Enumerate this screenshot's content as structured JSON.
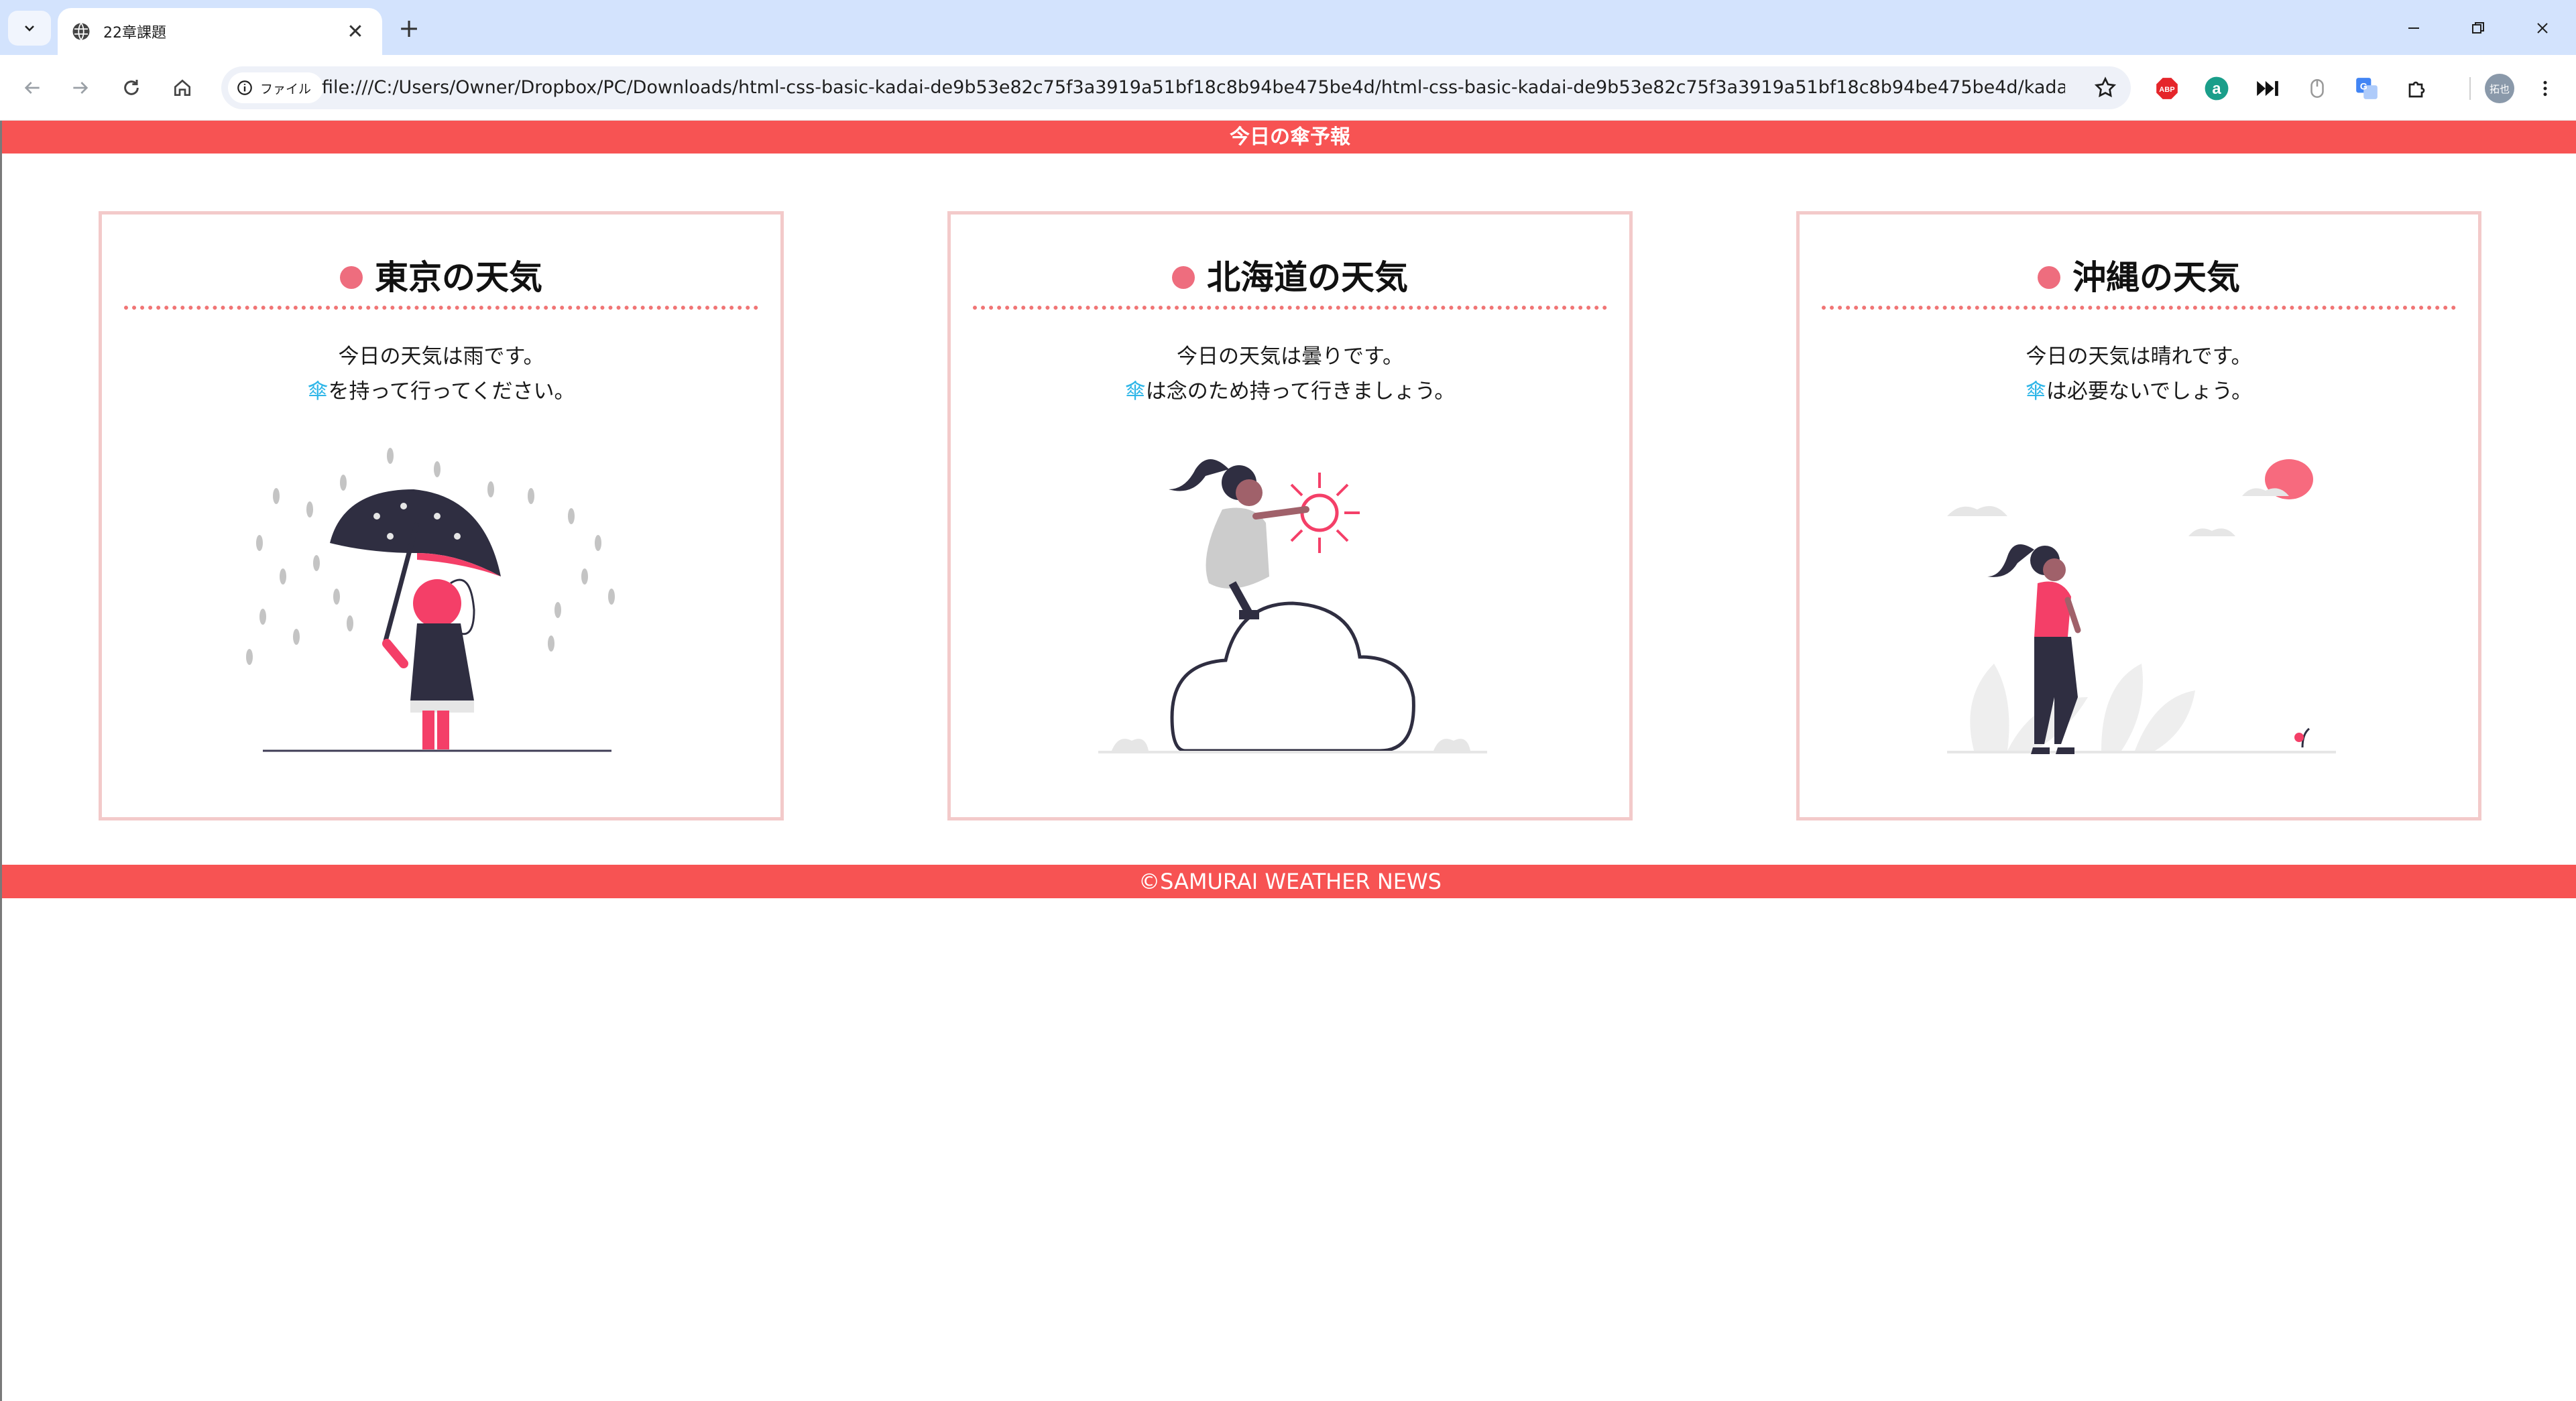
{
  "browser": {
    "tab_title": "22章課題",
    "chip_label": "ファイル",
    "url": "file:///C:/Users/Owner/Dropbox/PC/Downloads/html-css-basic-kadai-de9b53e82c75f3a3919a51bf18c8b94be475be4d/html-css-basic-kadai-de9b53e82c75f3a3919a51bf18c8b94be475be4d/kadai_022/k...",
    "profile_label": "拓也",
    "extensions": [
      "adblock-icon",
      "amazon-assistant-icon",
      "media-skip-icon",
      "mouse-icon",
      "translate-icon",
      "puzzle-icon"
    ]
  },
  "header": {
    "title": "今日の傘予報"
  },
  "cards": [
    {
      "title": "東京の天気",
      "line1": "今日の天気は雨です。",
      "umbrella": "傘",
      "line2_rest": "を持って行ってください。",
      "illustration": "rainy-umbrella-girl"
    },
    {
      "title": "北海道の天気",
      "line1": "今日の天気は曇りです。",
      "umbrella": "傘",
      "line2_rest": "は念のため持って行きましょう。",
      "illustration": "girl-on-cloud-with-sun"
    },
    {
      "title": "沖縄の天気",
      "line1": "今日の天気は晴れです。",
      "umbrella": "傘",
      "line2_rest": "は必要ないでしょう。",
      "illustration": "girl-walking-sunny"
    }
  ],
  "footer": {
    "text": "©SAMURAI WEATHER NEWS"
  },
  "colors": {
    "brand_red": "#f75353",
    "card_border": "#f3caca",
    "dot": "#ee6d7e",
    "umbrella_blue": "#2fb6e8",
    "accent_pink": "#f43f68",
    "dark_navy": "#2f2e41"
  }
}
